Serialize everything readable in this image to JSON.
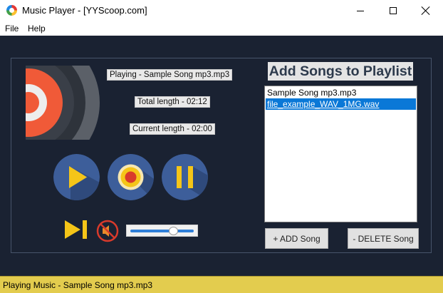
{
  "window": {
    "title": "Music Player - [YYScoop.com]"
  },
  "menu": {
    "file_label": "File",
    "help_label": "Help"
  },
  "player": {
    "playing_text": "Playing - Sample Song mp3.mp3",
    "total_length_text": "Total length - 02:12",
    "current_length_text": "Current length - 02:00",
    "volume_fraction": 0.68
  },
  "playlist": {
    "heading": "Add Songs to Playlist",
    "items": [
      {
        "label": "Sample Song mp3.mp3",
        "selected": false
      },
      {
        "label": "file_example_WAV_1MG.wav",
        "selected": true
      }
    ],
    "add_label": "+ ADD Song",
    "delete_label": "- DELETE Song"
  },
  "status": {
    "text": "Playing Music - Sample Song mp3.mp3"
  },
  "colors": {
    "background": "#1a2232",
    "status_bar": "#e3cc4e",
    "button_circle": "#3d5e9a",
    "accent_yellow": "#f5c518",
    "accent_red": "#d93a2b",
    "selection": "#0a78d7"
  },
  "icons": {
    "app": "music-disc-icon",
    "play": "play-icon",
    "record": "record-icon",
    "pause": "pause-icon",
    "next": "skip-next-icon",
    "mute": "mute-icon"
  }
}
